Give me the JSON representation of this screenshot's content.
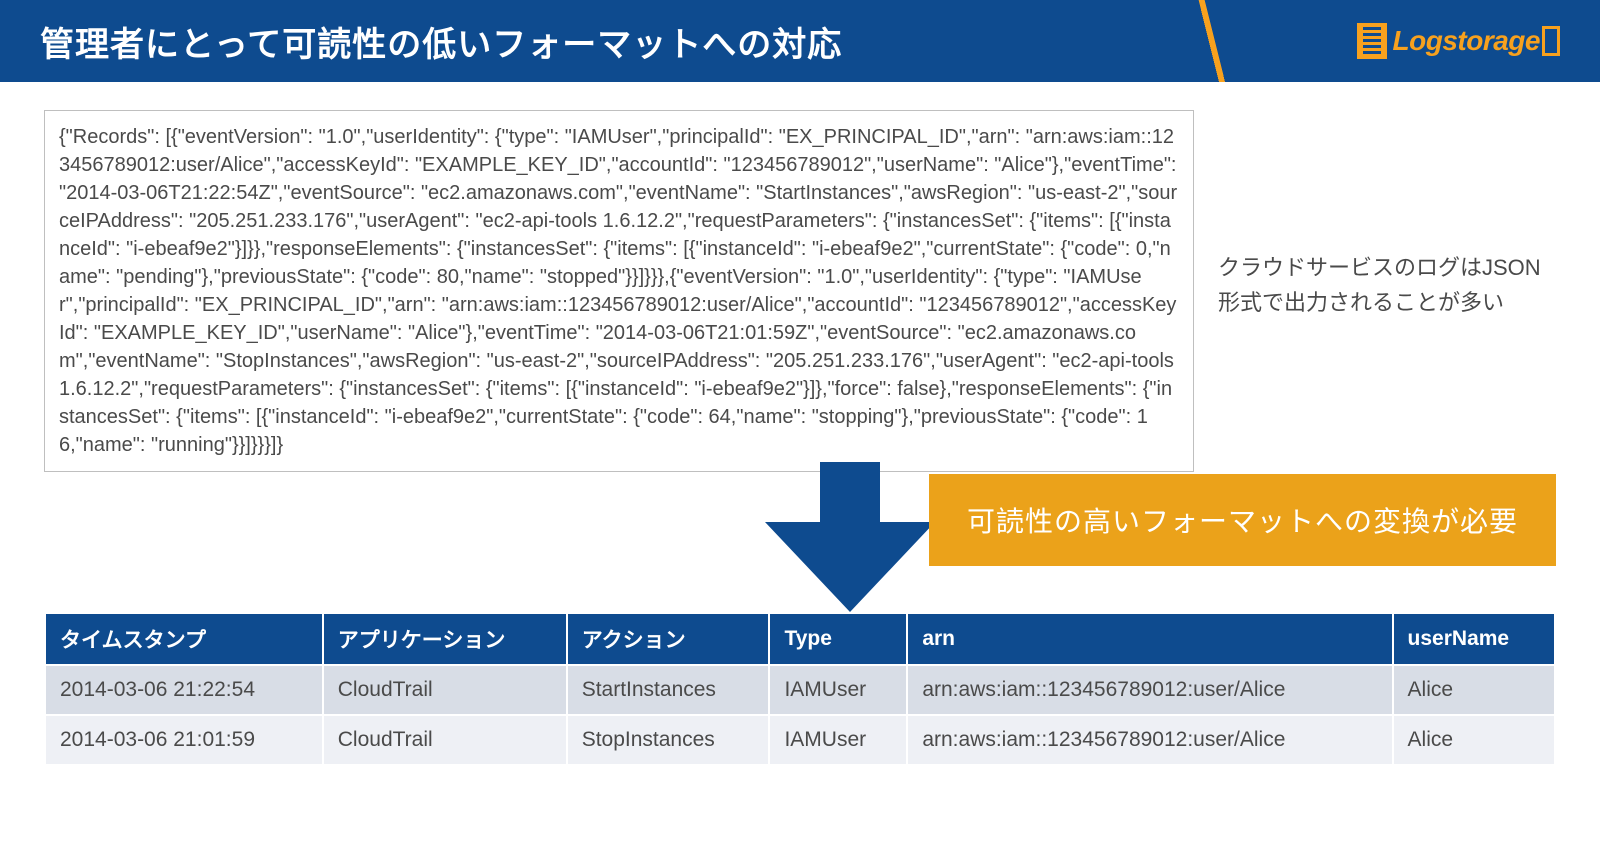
{
  "header": {
    "title": "管理者にとって可読性の低いフォーマットへの対応",
    "logo_text": "Logstorage"
  },
  "json_sample": "{\"Records\": [{\"eventVersion\": \"1.0\",\"userIdentity\": {\"type\": \"IAMUser\",\"principalId\": \"EX_PRINCIPAL_ID\",\"arn\": \"arn:aws:iam::123456789012:user/Alice\",\"accessKeyId\": \"EXAMPLE_KEY_ID\",\"accountId\": \"123456789012\",\"userName\": \"Alice\"},\"eventTime\": \"2014-03-06T21:22:54Z\",\"eventSource\": \"ec2.amazonaws.com\",\"eventName\": \"StartInstances\",\"awsRegion\": \"us-east-2\",\"sourceIPAddress\": \"205.251.233.176\",\"userAgent\": \"ec2-api-tools 1.6.12.2\",\"requestParameters\": {\"instancesSet\": {\"items\": [{\"instanceId\": \"i-ebeaf9e2\"}]}},\"responseElements\": {\"instancesSet\": {\"items\": [{\"instanceId\": \"i-ebeaf9e2\",\"currentState\": {\"code\": 0,\"name\": \"pending\"},\"previousState\": {\"code\": 80,\"name\": \"stopped\"}}]}}},{\"eventVersion\": \"1.0\",\"userIdentity\": {\"type\": \"IAMUser\",\"principalId\": \"EX_PRINCIPAL_ID\",\"arn\": \"arn:aws:iam::123456789012:user/Alice\",\"accountId\": \"123456789012\",\"accessKeyId\": \"EXAMPLE_KEY_ID\",\"userName\": \"Alice\"},\"eventTime\": \"2014-03-06T21:01:59Z\",\"eventSource\": \"ec2.amazonaws.com\",\"eventName\": \"StopInstances\",\"awsRegion\": \"us-east-2\",\"sourceIPAddress\": \"205.251.233.176\",\"userAgent\": \"ec2-api-tools 1.6.12.2\",\"requestParameters\": {\"instancesSet\": {\"items\": [{\"instanceId\": \"i-ebeaf9e2\"}]},\"force\": false},\"responseElements\": {\"instancesSet\": {\"items\": [{\"instanceId\": \"i-ebeaf9e2\",\"currentState\": {\"code\": 64,\"name\": \"stopping\"},\"previousState\": {\"code\": 16,\"name\": \"running\"}}]}}}]}",
  "side_note": "クラウドサービスのログはJSON形式で出力されることが多い",
  "callout": "可読性の高いフォーマットへの変換が必要",
  "table": {
    "headers": [
      "タイムスタンプ",
      "アプリケーション",
      "アクション",
      "Type",
      "arn",
      "userName"
    ],
    "rows": [
      [
        "2014-03-06 21:22:54",
        "CloudTrail",
        "StartInstances",
        "IAMUser",
        "arn:aws:iam::123456789012:user/Alice",
        "Alice"
      ],
      [
        "2014-03-06 21:01:59",
        "CloudTrail",
        "StopInstances",
        "IAMUser",
        "arn:aws:iam::123456789012:user/Alice",
        "Alice"
      ]
    ]
  }
}
